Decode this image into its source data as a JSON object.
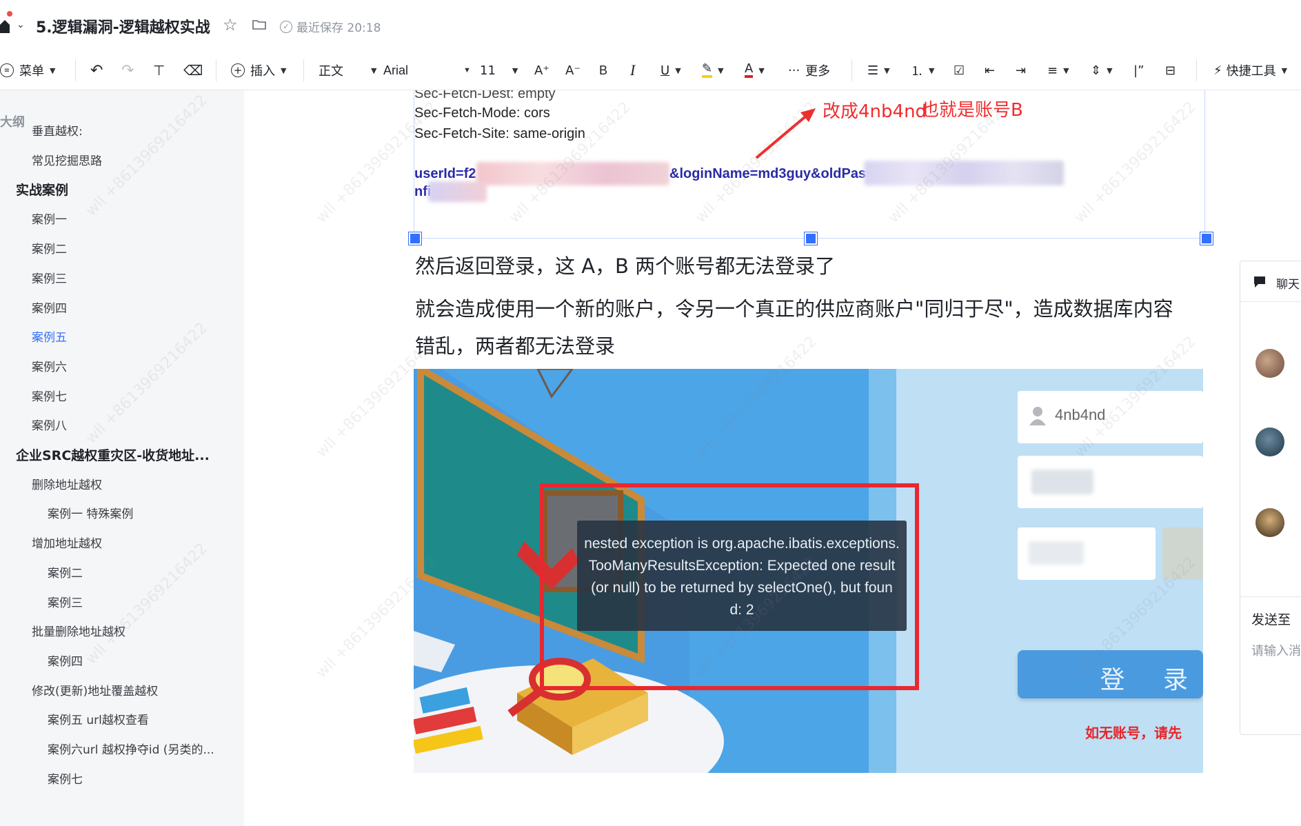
{
  "window": {
    "doc_title": "5.逻辑漏洞-逻辑越权实战",
    "save_status": "最近保存 20:18"
  },
  "toolbar": {
    "menu": "菜单",
    "insert": "插入",
    "paragraph_style": "正文",
    "font_family": "Arial",
    "font_size": "11",
    "more": "更多",
    "quick_tools": "快捷工具"
  },
  "outline": {
    "title": "大纲",
    "items": [
      {
        "label": "垂直越权:",
        "level": 2
      },
      {
        "label": "常见挖掘思路",
        "level": 2
      },
      {
        "label": "实战案例",
        "level": 1
      },
      {
        "label": "案例一",
        "level": 2
      },
      {
        "label": "案例二",
        "level": 2
      },
      {
        "label": "案例三",
        "level": 2
      },
      {
        "label": "案例四",
        "level": 2
      },
      {
        "label": "案例五",
        "level": 2,
        "active": true
      },
      {
        "label": "案例六",
        "level": 2
      },
      {
        "label": "案例七",
        "level": 2
      },
      {
        "label": "案例八",
        "level": 2
      },
      {
        "label": "企业SRC越权重灾区-收货地址...",
        "level": 1
      },
      {
        "label": "删除地址越权",
        "level": 2
      },
      {
        "label": "案例一 特殊案例",
        "level": 3
      },
      {
        "label": "增加地址越权",
        "level": 2
      },
      {
        "label": "案例二",
        "level": 3
      },
      {
        "label": "案例三",
        "level": 3
      },
      {
        "label": "批量删除地址越权",
        "level": 2
      },
      {
        "label": "案例四",
        "level": 3
      },
      {
        "label": "修改(更新)地址覆盖越权",
        "level": 2
      },
      {
        "label": "案例五 url越权查看",
        "level": 3
      },
      {
        "label": "案例六url 越权挣夺id (另类的...",
        "level": 3
      },
      {
        "label": "案例七",
        "level": 3
      }
    ]
  },
  "document": {
    "http_lines": [
      "Sec-Fetch-Dest: empty",
      "Sec-Fetch-Mode: cors",
      "Sec-Fetch-Site: same-origin"
    ],
    "param_user_id": "userId=f2",
    "param_login": "&loginName=md3guy&oldPasswor",
    "param_cont": "nfi",
    "annotation_1": "改成4nb4nd",
    "annotation_2": "也就是账号B",
    "para_1": "然后返回登录，这 A，B 两个账号都无法登录了",
    "para_2_line1": "就会造成使用一个新的账户，令另一个真正的供应商账户\"同归于尽\"，造成数据库内容",
    "para_2_line2": "错乱，两者都无法登录",
    "screenshot": {
      "username": "4nb4nd",
      "error_lines": [
        "nested exception is org.apache.ibatis.exceptions.",
        "TooManyResultsException: Expected one result",
        "(or null) to be returned by selectOne(), but foun",
        "d: 2"
      ],
      "login_button": "登 录",
      "register_hint": "如无账号，请先"
    }
  },
  "chat": {
    "title": "聊天",
    "send_to": "发送至",
    "input_placeholder": "请输入消"
  },
  "watermark": "wll +8613969216422",
  "colors": {
    "accent": "#3370ff",
    "annotation_red": "#f02c2c",
    "sidebar_bg": "#f5f6f7"
  }
}
